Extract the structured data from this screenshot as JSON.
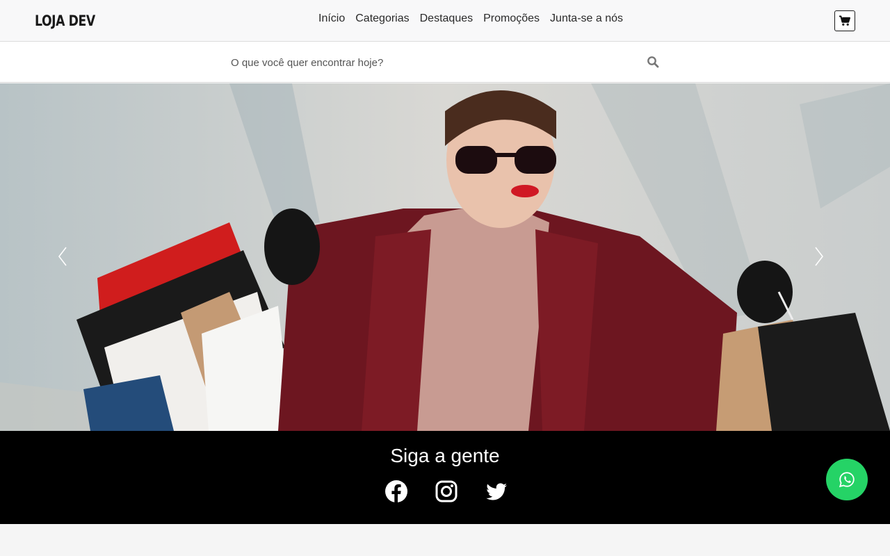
{
  "header": {
    "logo": "LOJA DEV",
    "nav": [
      "Início",
      "Categorias",
      "Destaques",
      "Promoções",
      "Junta-se a nós"
    ]
  },
  "search": {
    "placeholder": "O que você quer encontrar hoje?",
    "value": ""
  },
  "hero": {
    "image": "woman-with-shopping-bags-photo"
  },
  "follow": {
    "title": "Siga a gente",
    "networks": [
      "facebook-icon",
      "instagram-icon",
      "twitter-icon"
    ]
  },
  "colors": {
    "whatsapp": "#25d366",
    "footer_bg": "#000000",
    "header_bg": "#f8f8f9"
  }
}
